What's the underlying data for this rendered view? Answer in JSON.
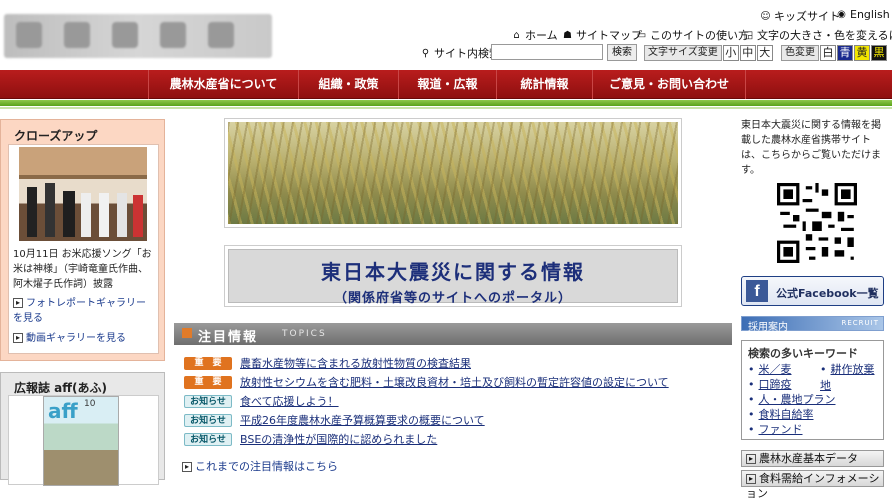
{
  "header": {
    "logo_alt": "",
    "top_links": {
      "kids": "キッズサイト",
      "english": "English"
    },
    "util_links": {
      "home": "ホーム",
      "sitemap": "サイトマップ",
      "howto": "このサイトの使い方",
      "fontcolor": "文字の大きさ・色を変えるには"
    },
    "search": {
      "label": "サイト内検索",
      "placeholder": "",
      "button": "検索"
    },
    "font_size": {
      "label": "文字サイズ変更",
      "small": "小",
      "medium": "中",
      "large": "大"
    },
    "color": {
      "label": "色変更",
      "white": "白",
      "blue": "青",
      "yellow": "黄",
      "black": "黒"
    }
  },
  "nav": [
    "農林水産省について",
    "組織・政策",
    "報道・広報",
    "統計情報",
    "ご意見・お問い合わせ"
  ],
  "closeup": {
    "title": "クローズアップ",
    "caption": "10月11日 お米応援ソング「お米は神様」（宇崎竜童氏作曲、阿木燿子氏作詞）披露",
    "links": [
      "フォトレポートギャラリーを見る",
      "動画ギャラリーを見る"
    ]
  },
  "magazine": {
    "title": "広報誌 aff(あふ)",
    "cover_text": "aff",
    "cover_issue": "10"
  },
  "quake": {
    "title": "東日本大震災に関する情報",
    "subtitle": "（関係府省等のサイトへのポータル）"
  },
  "topics": {
    "title": "注目情報",
    "title_en": "TOPICS",
    "items": [
      {
        "tag": "重　要",
        "type": "imp",
        "text": "農畜水産物等に含まれる放射性物質の検査結果"
      },
      {
        "tag": "重　要",
        "type": "imp",
        "text": "放射性セシウムを含む肥料・土壌改良資材・培土及び飼料の暫定許容値の設定について"
      },
      {
        "tag": "お知らせ",
        "type": "info",
        "text": "食べて応援しよう！"
      },
      {
        "tag": "お知らせ",
        "type": "info",
        "text": "平成26年度農林水産予算概算要求の概要について"
      },
      {
        "tag": "お知らせ",
        "type": "info",
        "text": "BSEの清浄性が国際的に認められました"
      }
    ],
    "more": "これまでの注目情報はこちら"
  },
  "right": {
    "mobile_text": "東日本大震災に関する情報を掲載した農林水産省携帯サイトは、こちらからご覧いただけます。",
    "facebook": "公式Facebook一覧",
    "recruit": "採用案内",
    "recruit_en": "RECRUIT",
    "keywords": {
      "title": "検索の多いキーワード",
      "items": [
        "米／麦",
        "耕作放棄地",
        "口蹄疫",
        "人・農地プラン",
        "食料自給率",
        "ファンド"
      ]
    },
    "basic_data": "農林水産基本データ",
    "supply_info": "食料需給インフォメーション"
  },
  "colors": {
    "nav_red": "#a01515",
    "green": "#6db32b",
    "topic_orange": "#e0731f",
    "link_blue": "#1a2f7a"
  }
}
